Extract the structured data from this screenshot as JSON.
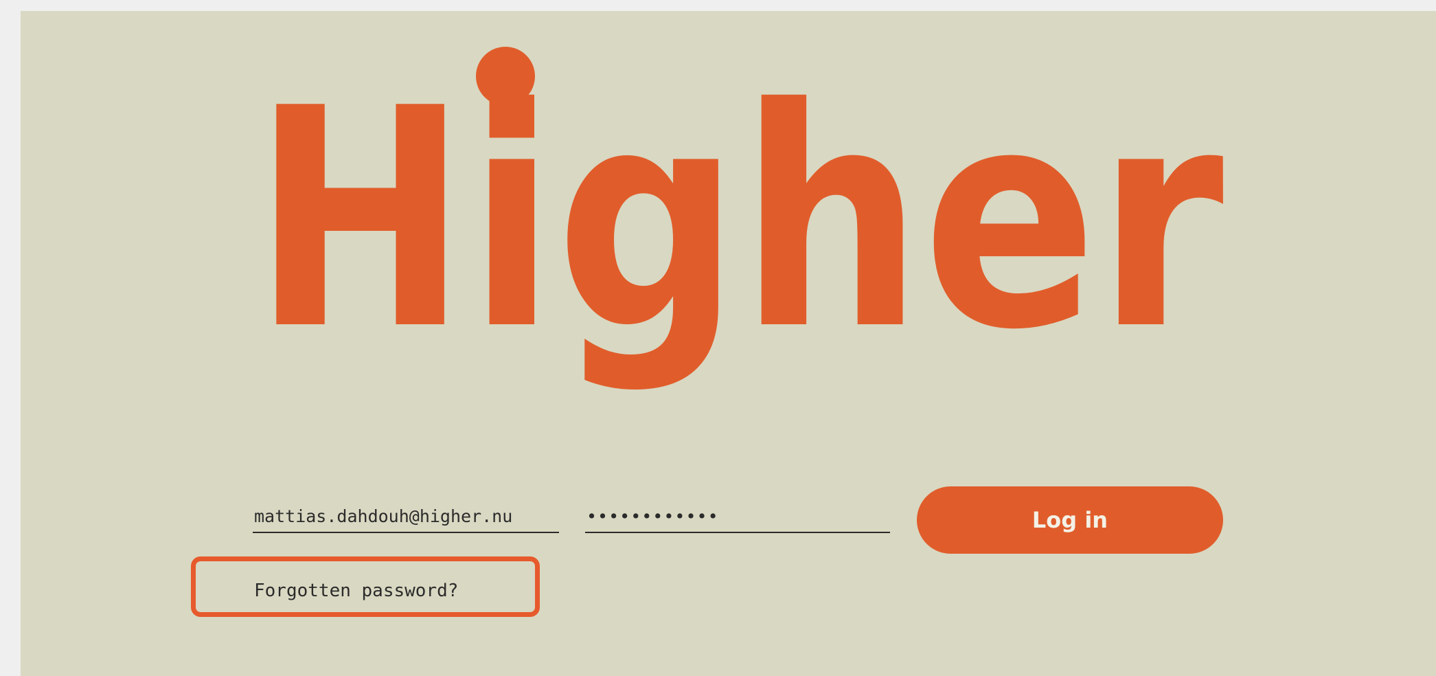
{
  "brand": {
    "logo_text": "Higher",
    "color": "#e05d2b"
  },
  "login_form": {
    "email_value": "mattias.dahdouh@higher.nu",
    "password_value": "••••••••••••",
    "login_button_label": "Log in",
    "forgot_password_label": "Forgotten password?"
  },
  "colors": {
    "background": "#d9d8c2",
    "accent": "#e05d2b",
    "text": "#2b2b2b"
  }
}
